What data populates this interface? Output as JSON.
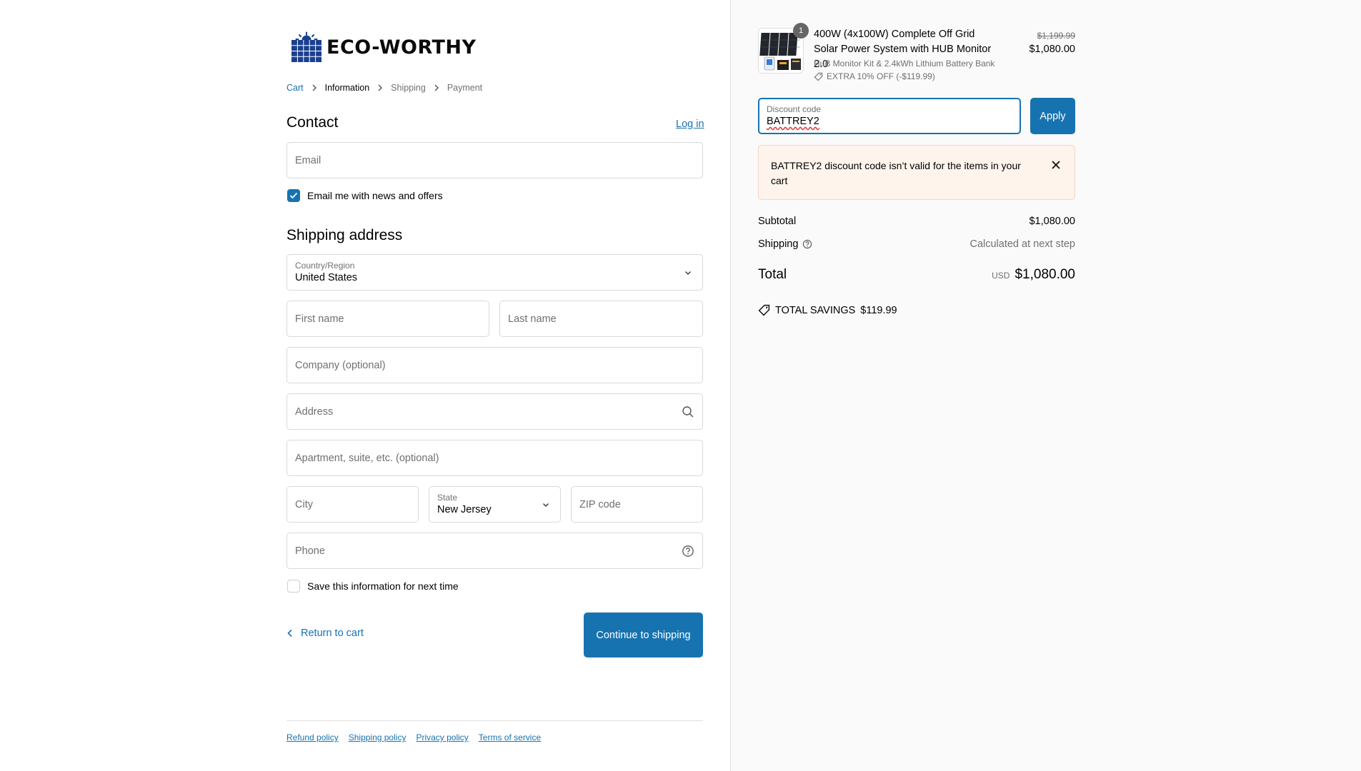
{
  "brand": {
    "name": "ECO-WORTHY",
    "color": "#1b3f8f"
  },
  "breadcrumb": [
    {
      "label": "Cart",
      "state": "link"
    },
    {
      "label": "Information",
      "state": "current"
    },
    {
      "label": "Shipping",
      "state": "upcoming"
    },
    {
      "label": "Payment",
      "state": "upcoming"
    }
  ],
  "contact": {
    "title": "Contact",
    "login_label": "Log in",
    "email_placeholder": "Email",
    "newsletter_label": "Email me with news and offers",
    "newsletter_checked": true
  },
  "shipping": {
    "title": "Shipping address",
    "country_label": "Country/Region",
    "country_value": "United States",
    "first_name_placeholder": "First name",
    "last_name_placeholder": "Last name",
    "company_placeholder": "Company (optional)",
    "address_placeholder": "Address",
    "apartment_placeholder": "Apartment, suite, etc. (optional)",
    "city_placeholder": "City",
    "state_label": "State",
    "state_value": "New Jersey",
    "zip_placeholder": "ZIP code",
    "phone_placeholder": "Phone",
    "save_label": "Save this information for next time",
    "save_checked": false
  },
  "actions": {
    "return_label": "Return to cart",
    "continue_label": "Continue to shipping"
  },
  "footer": {
    "links": [
      "Refund policy",
      "Shipping policy",
      "Privacy policy",
      "Terms of service"
    ]
  },
  "order": {
    "item": {
      "quantity": "1",
      "title": "400W (4x100W) Complete Off Grid Solar Power System with HUB Monitor 2.0",
      "variant": "HuB Monitor Kit & 2.4kWh Lithium Battery Bank",
      "discount": "EXTRA 10% OFF (-$119.99)",
      "price_original": "$1,199.99",
      "price_final": "$1,080.00"
    },
    "discount": {
      "label": "Discount code",
      "value": "BATTREY2",
      "apply_label": "Apply",
      "error": "BATTREY2 discount code isn’t valid for the items in your cart"
    },
    "subtotal_label": "Subtotal",
    "subtotal_value": "$1,080.00",
    "shipping_label": "Shipping",
    "shipping_value": "Calculated at next step",
    "total_label": "Total",
    "total_currency": "USD",
    "total_value": "$1,080.00",
    "savings_label": "TOTAL SAVINGS",
    "savings_value": "$119.99"
  },
  "colors": {
    "accent": "#1773b0",
    "error_bg": "#fff4ec",
    "muted": "#707070"
  }
}
